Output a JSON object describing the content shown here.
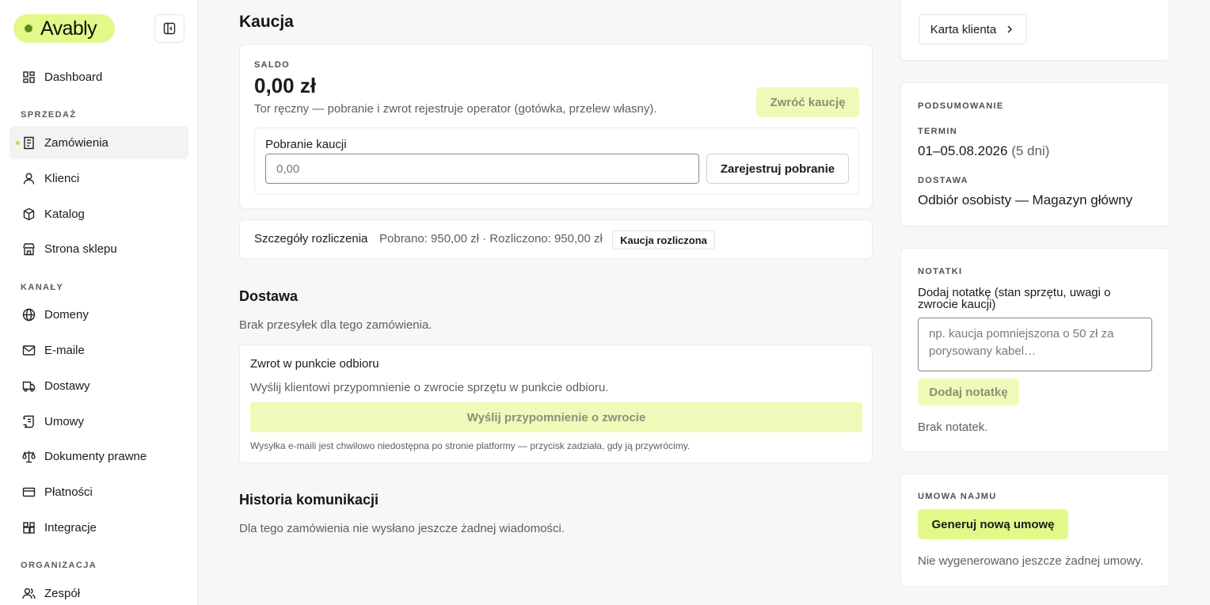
{
  "brand": {
    "name": "Avably"
  },
  "sidebar": {
    "items": [
      {
        "label": "Dashboard"
      },
      {
        "label": "Zamówienia"
      },
      {
        "label": "Klienci"
      },
      {
        "label": "Katalog"
      },
      {
        "label": "Strona sklepu"
      },
      {
        "label": "Domeny"
      },
      {
        "label": "E-maile"
      },
      {
        "label": "Dostawy"
      },
      {
        "label": "Umowy"
      },
      {
        "label": "Dokumenty prawne"
      },
      {
        "label": "Płatności"
      },
      {
        "label": "Integracje"
      },
      {
        "label": "Zespół"
      }
    ],
    "sections": {
      "sales": "SPRZEDAŻ",
      "channels": "KANAŁY",
      "organization": "ORGANIZACJA"
    },
    "active_item": "Zamówienia"
  },
  "deposit": {
    "title": "Kaucja",
    "balance_label": "SALDO",
    "balance_value": "0,00 zł",
    "description": "Tor ręczny — pobranie i zwrot rejestruje operator (gotówka, przelew własny).",
    "return_button": "Zwróć kaucję",
    "collect_label": "Pobranie kaucji",
    "collect_placeholder": "0,00",
    "collect_button": "Zarejestruj pobranie"
  },
  "settlement": {
    "label": "Szczegóły rozliczenia",
    "details": "Pobrano: 950,00 zł · Rozliczono: 950,00 zł",
    "badge": "Kaucja rozliczona"
  },
  "delivery": {
    "title": "Dostawa",
    "empty": "Brak przesyłek dla tego zamówienia.",
    "return_card": {
      "title": "Zwrot w punkcie odbioru",
      "description": "Wyślij klientowi przypomnienie o zwrocie sprzętu w punkcie odbioru.",
      "button": "Wyślij przypomnienie o zwrocie",
      "note": "Wysyłka e-maili jest chwilowo niedostępna po stronie platformy — przycisk zadziała, gdy ją przywrócimy."
    }
  },
  "history": {
    "title": "Historia komunikacji",
    "empty": "Dla tego zamówienia nie wysłano jeszcze żadnej wiadomości."
  },
  "customer_card": {
    "button": "Karta klienta"
  },
  "summary": {
    "label": "PODSUMOWANIE",
    "term_label": "TERMIN",
    "term_value": "01–05.08.2026",
    "term_days": "(5 dni)",
    "delivery_label": "DOSTAWA",
    "delivery_value": "Odbiór osobisty — Magazyn główny"
  },
  "notes": {
    "label": "NOTATKI",
    "prompt": "Dodaj notatkę (stan sprzętu, uwagi o zwrocie kaucji)",
    "placeholder": "np. kaucja pomniejszona o 50 zł za porysowany kabel…",
    "button": "Dodaj notatkę",
    "empty": "Brak notatek."
  },
  "contract": {
    "label": "UMOWA NAJMU",
    "button": "Generuj nową umowę",
    "empty": "Nie wygenerowano jeszcze żadnej umowy."
  },
  "colors": {
    "accent": "#e2f98a",
    "accent_disabled": "#eefbb8",
    "background": "#f7f7f6"
  }
}
